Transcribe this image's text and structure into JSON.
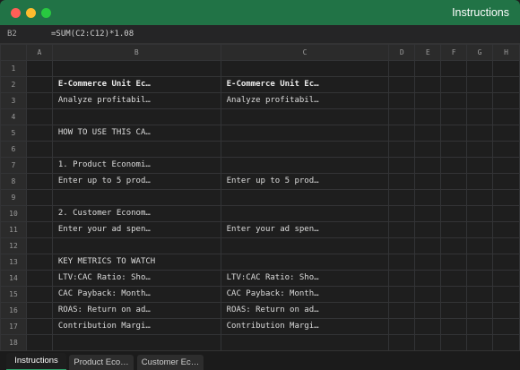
{
  "window": {
    "title": "Instructions"
  },
  "formula_bar": {
    "cell_ref": "B2",
    "formula": "=SUM(C2:C12)*1.08"
  },
  "columns": [
    "A",
    "B",
    "C",
    "D",
    "E",
    "F",
    "G",
    "H"
  ],
  "rows": [
    {
      "num": "1",
      "b": "",
      "c": "",
      "bold": false
    },
    {
      "num": "2",
      "b": "E-Commerce Unit Ec…",
      "c": "E-Commerce Unit Ec…",
      "bold": true
    },
    {
      "num": "3",
      "b": "Analyze profitabil…",
      "c": "Analyze profitabil…",
      "bold": false
    },
    {
      "num": "4",
      "b": "",
      "c": "",
      "bold": false
    },
    {
      "num": "5",
      "b": "HOW TO USE THIS CA…",
      "c": "",
      "bold": false
    },
    {
      "num": "6",
      "b": "",
      "c": "",
      "bold": false
    },
    {
      "num": "7",
      "b": "1. Product Economi…",
      "c": "",
      "bold": false
    },
    {
      "num": "8",
      "b": "Enter up to 5 prod…",
      "c": "Enter up to 5 prod…",
      "bold": false
    },
    {
      "num": "9",
      "b": "",
      "c": "",
      "bold": false
    },
    {
      "num": "10",
      "b": "2. Customer Econom…",
      "c": "",
      "bold": false
    },
    {
      "num": "11",
      "b": "Enter your ad spen…",
      "c": "Enter your ad spen…",
      "bold": false
    },
    {
      "num": "12",
      "b": "",
      "c": "",
      "bold": false
    },
    {
      "num": "13",
      "b": "KEY METRICS TO WATCH",
      "c": "",
      "bold": false
    },
    {
      "num": "14",
      "b": "LTV:CAC Ratio: Sho…",
      "c": "LTV:CAC Ratio: Sho…",
      "bold": false
    },
    {
      "num": "15",
      "b": "CAC Payback: Month…",
      "c": "CAC Payback: Month…",
      "bold": false
    },
    {
      "num": "16",
      "b": "ROAS: Return on ad…",
      "c": "ROAS: Return on ad…",
      "bold": false
    },
    {
      "num": "17",
      "b": "Contribution Margi…",
      "c": "Contribution Margi…",
      "bold": false
    },
    {
      "num": "18",
      "b": "",
      "c": "",
      "bold": false
    }
  ],
  "sheet_tabs": [
    {
      "label": "Instructions",
      "active": true
    },
    {
      "label": "Product Eco…",
      "active": false
    },
    {
      "label": "Customer Ec…",
      "active": false
    }
  ],
  "colors": {
    "titlebar": "#217346",
    "active_tab_accent": "#2fa36b"
  }
}
